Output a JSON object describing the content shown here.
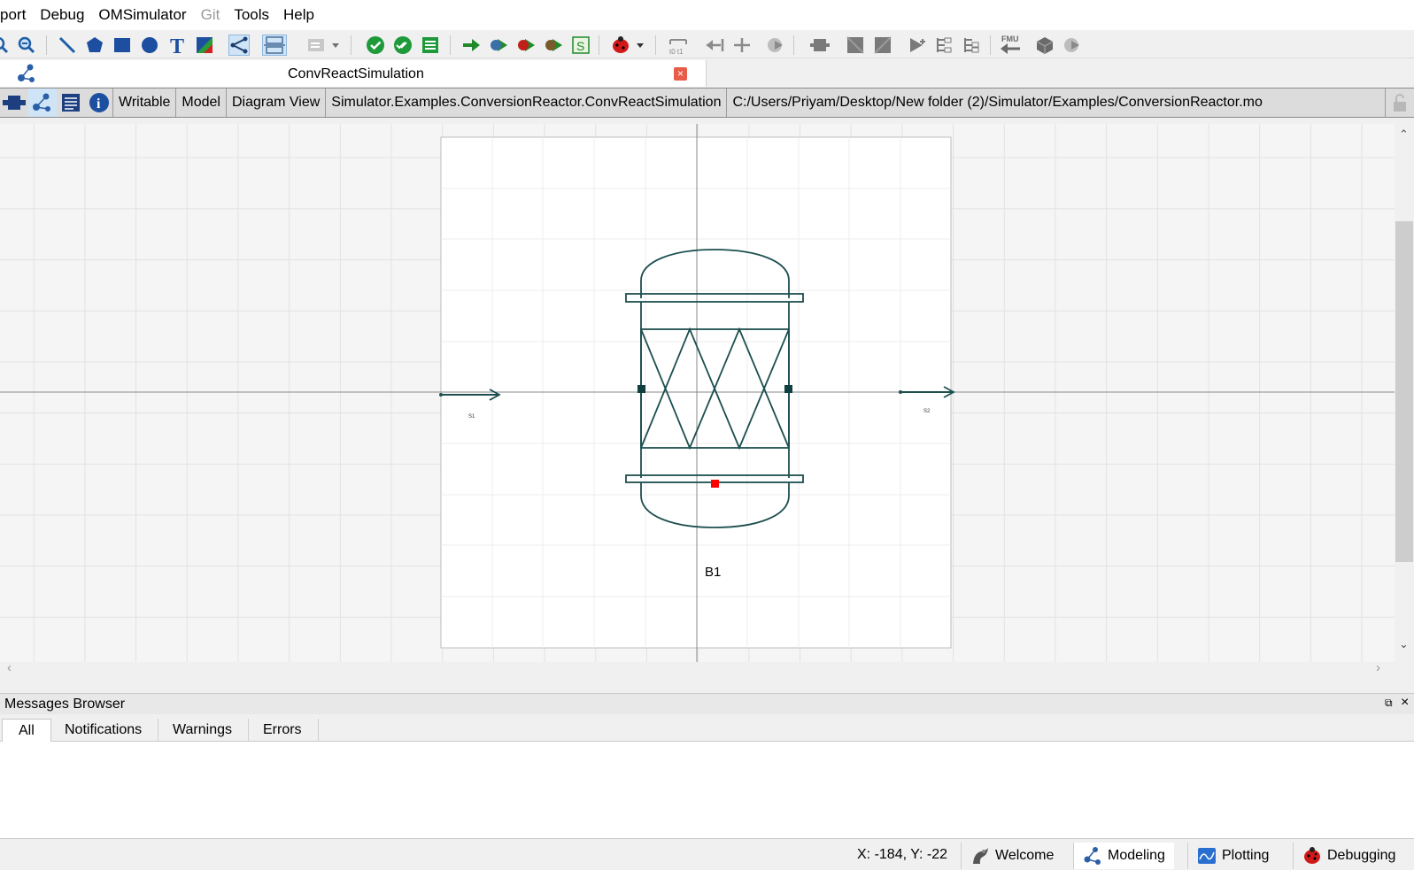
{
  "menubar": {
    "items": [
      {
        "label": "port",
        "enabled": true
      },
      {
        "label": "Debug",
        "enabled": true
      },
      {
        "label": "OMSimulator",
        "enabled": true
      },
      {
        "label": "Git",
        "enabled": false
      },
      {
        "label": "Tools",
        "enabled": true
      },
      {
        "label": "Help",
        "enabled": true
      }
    ]
  },
  "toolbar": {
    "fmu_label": "FMU"
  },
  "document": {
    "tab_title": "ConvReactSimulation",
    "close_glyph": "×"
  },
  "infobar": {
    "writable": "Writable",
    "type": "Model",
    "view": "Diagram View",
    "class_path": "Simulator.Examples.ConversionReactor.ConvReactSimulation",
    "file_path": "C:/Users/Priyam/Desktop/New folder (2)/Simulator/Examples/ConversionReactor.mo"
  },
  "diagram": {
    "component_label": "B1",
    "inlet_label": "S1",
    "outlet_label": "S2",
    "colors": {
      "shape_stroke": "#1d4f4f",
      "port_fill": "#0f3f3f",
      "energy_port": "#ff0000",
      "axis_line": "#8a8a8a",
      "page_fill": "#ffffff"
    }
  },
  "messages": {
    "title": "Messages Browser",
    "tabs": [
      "All",
      "Notifications",
      "Warnings",
      "Errors"
    ],
    "selected_tab": "All"
  },
  "statusbar": {
    "coordinates": "X: -184, Y: -22",
    "perspectives": [
      {
        "label": "Welcome",
        "icon": "welcome-icon"
      },
      {
        "label": "Modeling",
        "icon": "modeling-icon",
        "selected": true
      },
      {
        "label": "Plotting",
        "icon": "plotting-icon"
      },
      {
        "label": "Debugging",
        "icon": "debugging-icon"
      }
    ]
  }
}
